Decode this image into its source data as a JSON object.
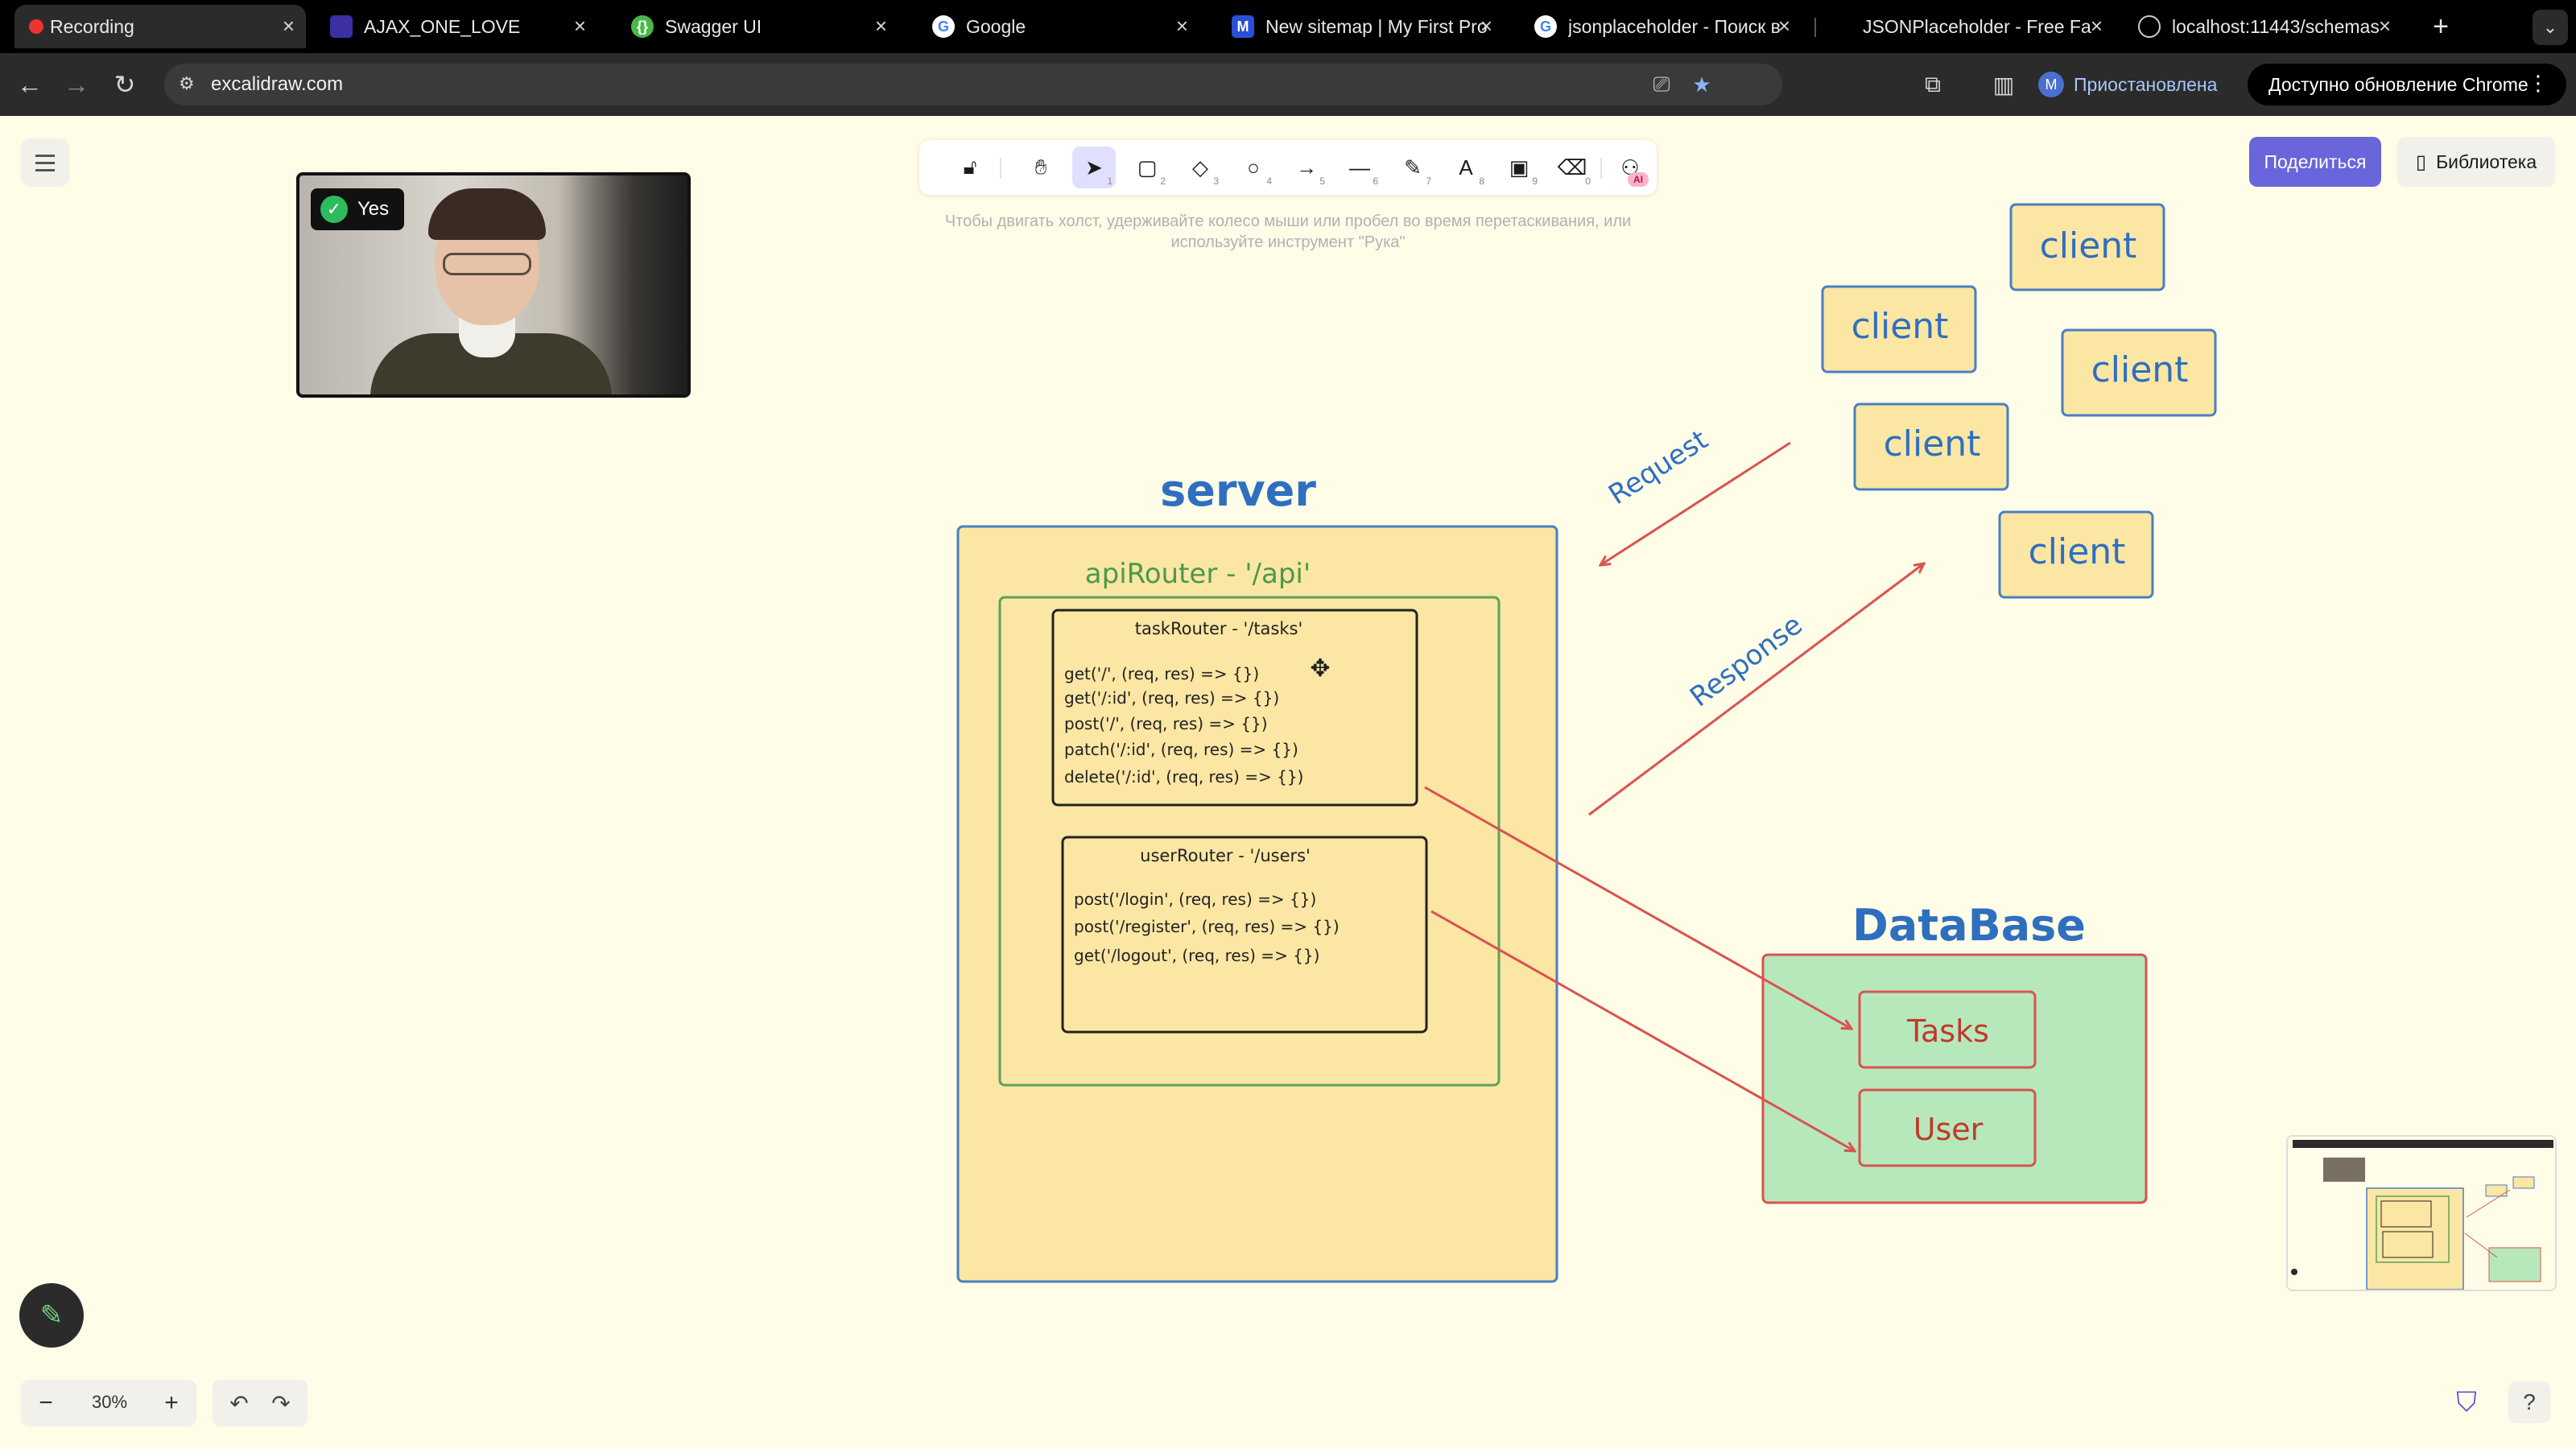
{
  "browser": {
    "tabs": [
      {
        "title": "Recording",
        "icon": "record-dot-icon",
        "active": true
      },
      {
        "title": "AJAX_ONE_LOVE",
        "icon": "square-favicon-icon",
        "active": false
      },
      {
        "title": "Swagger UI",
        "icon": "swagger-icon",
        "active": false
      },
      {
        "title": "Google",
        "icon": "google-icon",
        "active": false
      },
      {
        "title": "New sitemap | My First Pro",
        "icon": "miro-icon",
        "active": false
      },
      {
        "title": "jsonplaceholder - Поиск в",
        "icon": "google-icon",
        "active": false
      },
      {
        "title": "JSONPlaceholder - Free Fa",
        "icon": "none",
        "active": false
      },
      {
        "title": "localhost:11443/schemas",
        "icon": "globe-icon",
        "active": false
      }
    ],
    "new_tab_symbol": "+",
    "url": "excalidraw.com",
    "profile_initial": "M",
    "profile_status": "Приостановлена",
    "update_label": "Доступно обновление Chrome"
  },
  "excalidraw": {
    "hint": "Чтобы двигать холст, удерживайте колесо мыши или пробел во время перетаскивания, или используйте инструмент \"Рука\"",
    "share_label": "Поделиться",
    "library_label": "Библиотека",
    "zoom": "30%",
    "ai_badge": "AI",
    "tools": [
      {
        "icon": "lock-icon",
        "key": ""
      },
      {
        "icon": "hand-icon",
        "key": ""
      },
      {
        "icon": "selection-arrow-icon",
        "key": "1",
        "selected": true
      },
      {
        "icon": "rectangle-icon",
        "key": "2"
      },
      {
        "icon": "diamond-icon",
        "key": "3"
      },
      {
        "icon": "ellipse-icon",
        "key": "4"
      },
      {
        "icon": "arrow-icon",
        "key": "5"
      },
      {
        "icon": "line-icon",
        "key": "6"
      },
      {
        "icon": "pencil-icon",
        "key": "7"
      },
      {
        "icon": "text-icon",
        "key": "8"
      },
      {
        "icon": "image-icon",
        "key": "9"
      },
      {
        "icon": "eraser-icon",
        "key": "0"
      },
      {
        "icon": "more-tools-icon",
        "key": ""
      }
    ]
  },
  "webcam": {
    "badge": "Yes"
  },
  "diagram": {
    "server_title": "server",
    "api_router": "apiRouter - '/api'",
    "task_router": {
      "title": "taskRouter - '/tasks'",
      "routes": [
        "get('/', (req, res) => {})",
        "get('/:id', (req, res) => {})",
        "post('/', (req, res) => {})",
        "patch('/:id', (req, res) => {})",
        "delete('/:id', (req, res) => {})"
      ]
    },
    "user_router": {
      "title": "userRouter - '/users'",
      "routes": [
        "post('/login', (req, res) => {})",
        "post('/register', (req, res) => {})",
        "get('/logout', (req, res) => {})"
      ]
    },
    "clients": [
      "client",
      "client",
      "client",
      "client",
      "client"
    ],
    "request_label": "Request",
    "response_label": "Response",
    "database_title": "DataBase",
    "db_tables": [
      "Tasks",
      "User"
    ],
    "colors": {
      "server_stroke": "#4a7fc1",
      "server_fill": "#fbe6a3",
      "router_stroke": "#5ba35b",
      "client_fill": "#fbe6a3",
      "client_stroke": "#4a7fc1",
      "arrow": "#d9534f",
      "db_fill": "#b7e8bc",
      "db_stroke": "#d9534f",
      "title_blue": "#2f6fc0"
    }
  }
}
